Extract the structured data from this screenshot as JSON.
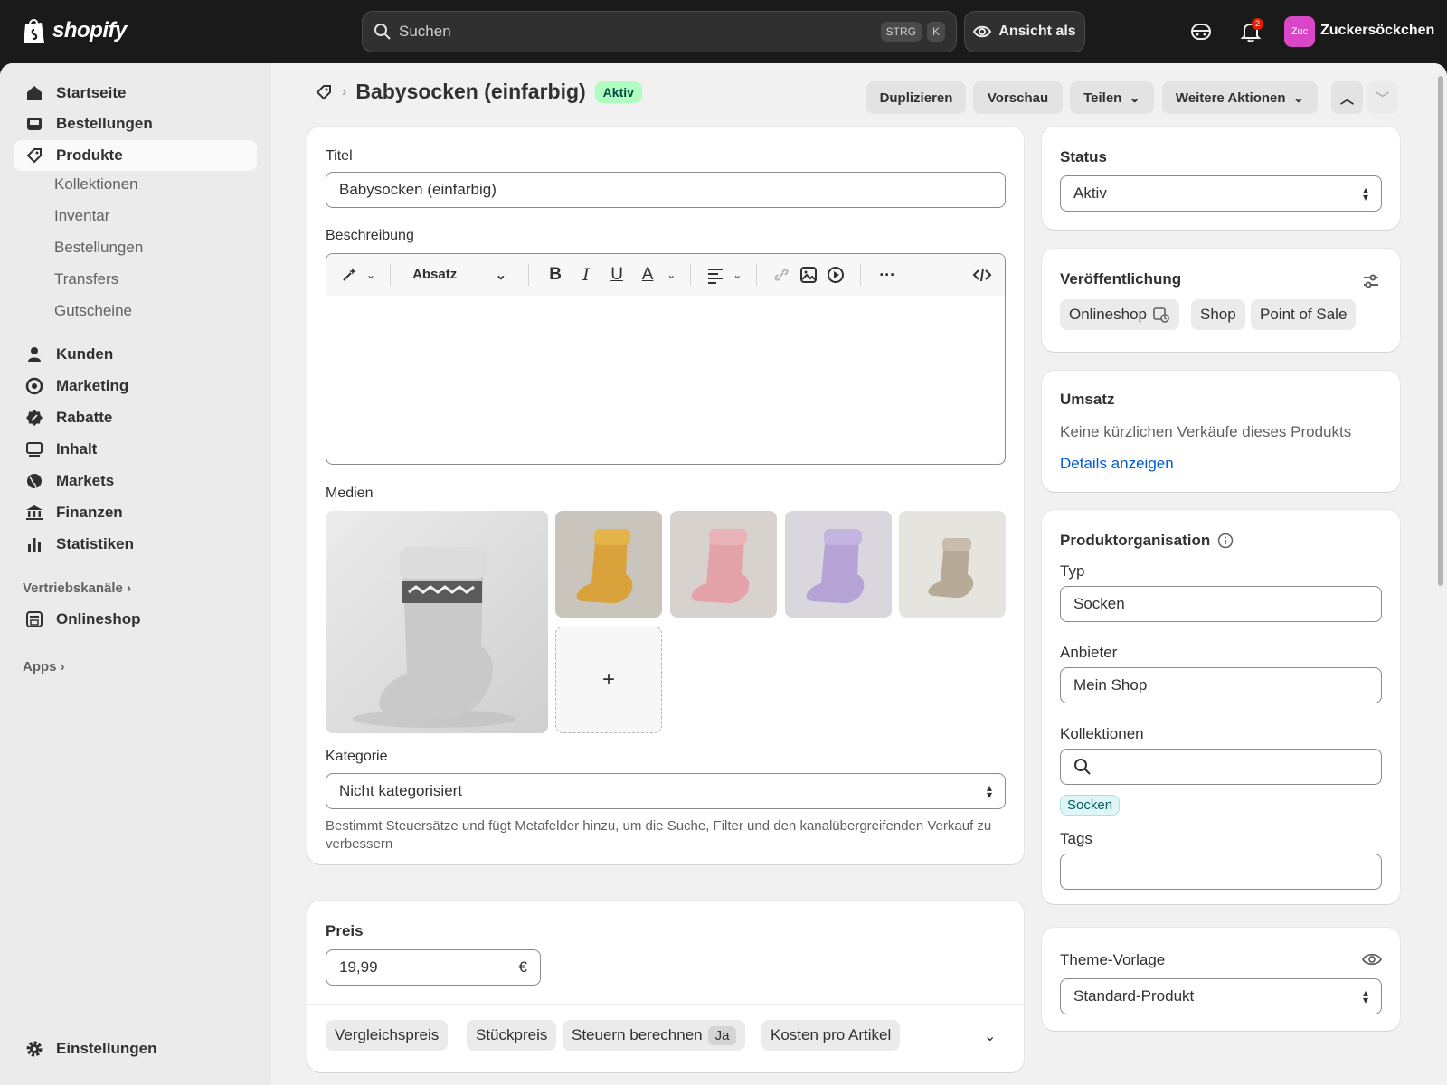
{
  "topbar": {
    "brand": "shopify",
    "search_placeholder": "Suchen",
    "kbd1": "STRG",
    "kbd2": "K",
    "view_as": "Ansicht als",
    "notification_count": "2",
    "avatar_initials": "Zuc",
    "store_name": "Zuckersöckchen"
  },
  "sidebar": {
    "items": [
      {
        "label": "Startseite",
        "icon": "home-icon"
      },
      {
        "label": "Bestellungen",
        "icon": "inbox-icon"
      },
      {
        "label": "Produkte",
        "icon": "tag-icon"
      },
      {
        "label": "Kunden",
        "icon": "person-icon"
      },
      {
        "label": "Marketing",
        "icon": "target-icon"
      },
      {
        "label": "Rabatte",
        "icon": "discount-icon"
      },
      {
        "label": "Inhalt",
        "icon": "content-icon"
      },
      {
        "label": "Markets",
        "icon": "globe-icon"
      },
      {
        "label": "Finanzen",
        "icon": "bank-icon"
      },
      {
        "label": "Statistiken",
        "icon": "chart-icon"
      }
    ],
    "sub_items": [
      "Kollektionen",
      "Inventar",
      "Bestellungen",
      "Transfers",
      "Gutscheine"
    ],
    "sales_channels_label": "Vertriebskanäle",
    "onlineshop": "Onlineshop",
    "apps_label": "Apps",
    "settings": "Einstellungen"
  },
  "header": {
    "title": "Babysocken (einfarbig)",
    "status_badge": "Aktiv",
    "duplicate": "Duplizieren",
    "preview": "Vorschau",
    "share": "Teilen",
    "more_actions": "Weitere Aktionen"
  },
  "main": {
    "title_label": "Titel",
    "title_value": "Babysocken (einfarbig)",
    "description_label": "Beschreibung",
    "paragraph_style": "Absatz",
    "media_label": "Medien",
    "media_add": "+",
    "category_label": "Kategorie",
    "category_value": "Nicht kategorisiert",
    "category_help": "Bestimmt Steuersätze und fügt Metafelder hinzu, um die Suche, Filter und den kanalübergreifenden Verkauf zu verbessern"
  },
  "price": {
    "label": "Preis",
    "value": "19,99",
    "currency": "€",
    "compare": "Vergleichspreis",
    "unit_price": "Stückpreis",
    "taxes": "Steuern berechnen",
    "taxes_value": "Ja",
    "cost": "Kosten pro Artikel"
  },
  "right": {
    "status_label": "Status",
    "status_value": "Aktiv",
    "publishing_label": "Veröffentlichung",
    "channels": [
      "Onlineshop",
      "Shop",
      "Point of Sale"
    ],
    "sales_label": "Umsatz",
    "sales_text": "Keine kürzlichen Verkäufe dieses Produkts",
    "sales_link": "Details anzeigen",
    "org_label": "Produktorganisation",
    "type_label": "Typ",
    "type_value": "Socken",
    "vendor_label": "Anbieter",
    "vendor_value": "Mein Shop",
    "collections_label": "Kollektionen",
    "collection_chip": "Socken",
    "tags_label": "Tags",
    "theme_label": "Theme-Vorlage",
    "theme_value": "Standard-Produkt"
  },
  "colors": {
    "topbar": "#1a1a1a",
    "active_badge": "#affebf",
    "link": "#005bd3"
  }
}
